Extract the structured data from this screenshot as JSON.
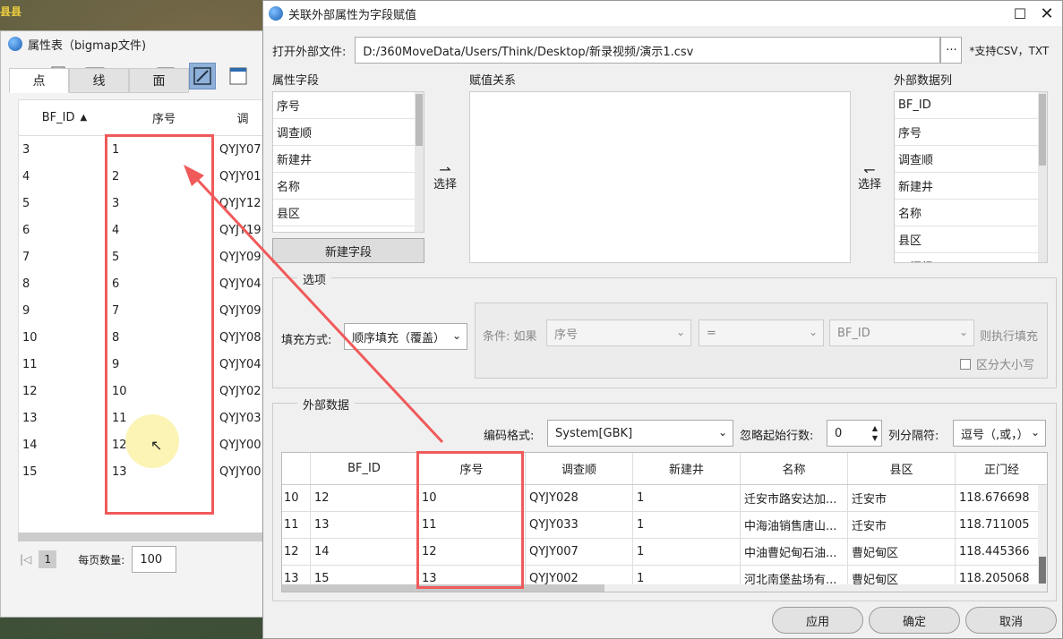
{
  "background": {
    "map_label": "县县"
  },
  "attr_window": {
    "title": "属性表（bigmap文件)",
    "tabs": [
      "点",
      "线",
      "面"
    ],
    "table": {
      "headers": [
        "BF_ID",
        "序号",
        "调"
      ],
      "rows": [
        [
          "3",
          "1",
          "QYJY07"
        ],
        [
          "4",
          "2",
          "QYJY01"
        ],
        [
          "5",
          "3",
          "QYJY12"
        ],
        [
          "6",
          "4",
          "QYJY19"
        ],
        [
          "7",
          "5",
          "QYJY09"
        ],
        [
          "8",
          "6",
          "QYJY04"
        ],
        [
          "9",
          "7",
          "QYJY09"
        ],
        [
          "10",
          "8",
          "QYJY08"
        ],
        [
          "11",
          "9",
          "QYJY04"
        ],
        [
          "12",
          "10",
          "QYJY02"
        ],
        [
          "13",
          "11",
          "QYJY03"
        ],
        [
          "14",
          "12",
          "QYJY00"
        ],
        [
          "15",
          "13",
          "QYJY00"
        ]
      ]
    },
    "pager": {
      "current_page": "1",
      "page_size_label": "每页数量:",
      "page_size": "100"
    }
  },
  "dialog": {
    "title": "关联外部属性为字段赋值",
    "open_file_label": "打开外部文件:",
    "file_path": "D:/360MoveData/Users/Think/Desktop/新录视频/演示1.csv",
    "browse_label": "···",
    "csv_note": "*支持CSV，TXT",
    "attr_fields_label": "属性字段",
    "attr_fields": [
      "序号",
      "调查顺",
      "新建井",
      "名称",
      "县区"
    ],
    "new_field_btn": "新建字段",
    "mapping_label": "赋值关系",
    "select_left": "选择",
    "select_right": "选择",
    "external_cols_label": "外部数据列",
    "external_cols": [
      "BF_ID",
      "序号",
      "调查顺",
      "新建井",
      "名称",
      "县区",
      "正门经"
    ],
    "options": {
      "title": "选项",
      "fill_mode_label": "填充方式:",
      "fill_mode_value": "顺序填充（覆盖）",
      "cond_label": "条件: 如果",
      "cond_field": "序号",
      "cond_op": "=",
      "cond_ext_field": "BF_ID",
      "cond_then": "则执行填充",
      "case_label": "区分大小写"
    },
    "external_data": {
      "title": "外部数据",
      "encoding_label": "编码格式:",
      "encoding_value": "System[GBK]",
      "skip_rows_label": "忽略起始行数:",
      "skip_rows_value": "0",
      "separator_label": "列分隔符:",
      "separator_value": "逗号（,或，）",
      "headers": [
        "BF_ID",
        "序号",
        "调查顺",
        "新建井",
        "名称",
        "县区",
        "正门经"
      ],
      "rows": [
        [
          "10",
          "12",
          "10",
          "QYJY028",
          "1",
          "迁安市路安达加...",
          "迁安市",
          "118.676698"
        ],
        [
          "11",
          "13",
          "11",
          "QYJY033",
          "1",
          "中海油销售唐山...",
          "迁安市",
          "118.711005"
        ],
        [
          "12",
          "14",
          "12",
          "QYJY007",
          "1",
          "中油曹妃甸石油...",
          "曹妃甸区",
          "118.445366"
        ],
        [
          "13",
          "15",
          "13",
          "QYJY002",
          "1",
          "河北南堡盐场有...",
          "曹妃甸区",
          "118.205068"
        ]
      ]
    },
    "buttons": {
      "apply": "应用",
      "ok": "确定",
      "cancel": "取消"
    }
  },
  "colors": {
    "highlight_red": "#f05a5a",
    "toolbar_active": "#8fb0d8"
  }
}
